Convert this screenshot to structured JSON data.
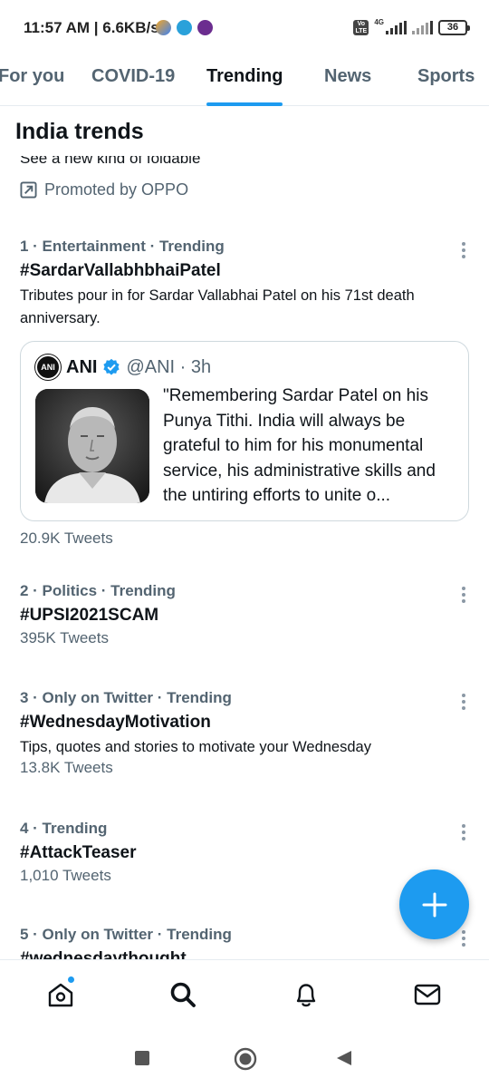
{
  "status_bar": {
    "time": "11:57 AM",
    "speed": "6.6KB/s",
    "network": "4G",
    "battery": "36"
  },
  "tabs": [
    {
      "label": "For you",
      "active": false
    },
    {
      "label": "COVID-19",
      "active": false
    },
    {
      "label": "Trending",
      "active": true
    },
    {
      "label": "News",
      "active": false
    },
    {
      "label": "Sports",
      "active": false
    }
  ],
  "section_title": "India trends",
  "promo": {
    "clipped_text": "See a new kind of foldable",
    "promoted_by": "Promoted by OPPO"
  },
  "trends": [
    {
      "meta": "1 · Entertainment · Trending",
      "name": "#SardarVallabhbhaiPatel",
      "desc": "Tributes pour in for Sardar Vallabhai Patel on his 71st death anniversary.",
      "count": "20.9K Tweets"
    },
    {
      "meta": "2 · Politics · Trending",
      "name": "#UPSI2021SCAM",
      "count": "395K Tweets"
    },
    {
      "meta": "3 · Only on Twitter · Trending",
      "name": "#WednesdayMotivation",
      "desc": "Tips, quotes and stories to motivate your Wednesday",
      "count": "13.8K Tweets"
    },
    {
      "meta": "4 · Trending",
      "name": "#AttackTeaser",
      "count": "1,010 Tweets"
    },
    {
      "meta": "5 · Only on Twitter · Trending",
      "name": "#wednesdaythought"
    }
  ],
  "embedded_tweet": {
    "logo_text": "ANI",
    "name": "ANI",
    "handle": "@ANI · 3h",
    "text": "\"Remembering Sardar Patel on his Punya Tithi. India will always be grateful to him for his monumental service, his administrative skills and the untiring efforts to unite o..."
  },
  "colors": {
    "accent": "#1d9bf0",
    "secondary_text": "#536471",
    "primary_text": "#0f1419"
  },
  "bottom_nav": [
    "home-icon",
    "search-icon",
    "notifications-icon",
    "messages-icon"
  ],
  "system_nav": [
    "recents-icon",
    "home-circle-icon",
    "back-icon"
  ]
}
